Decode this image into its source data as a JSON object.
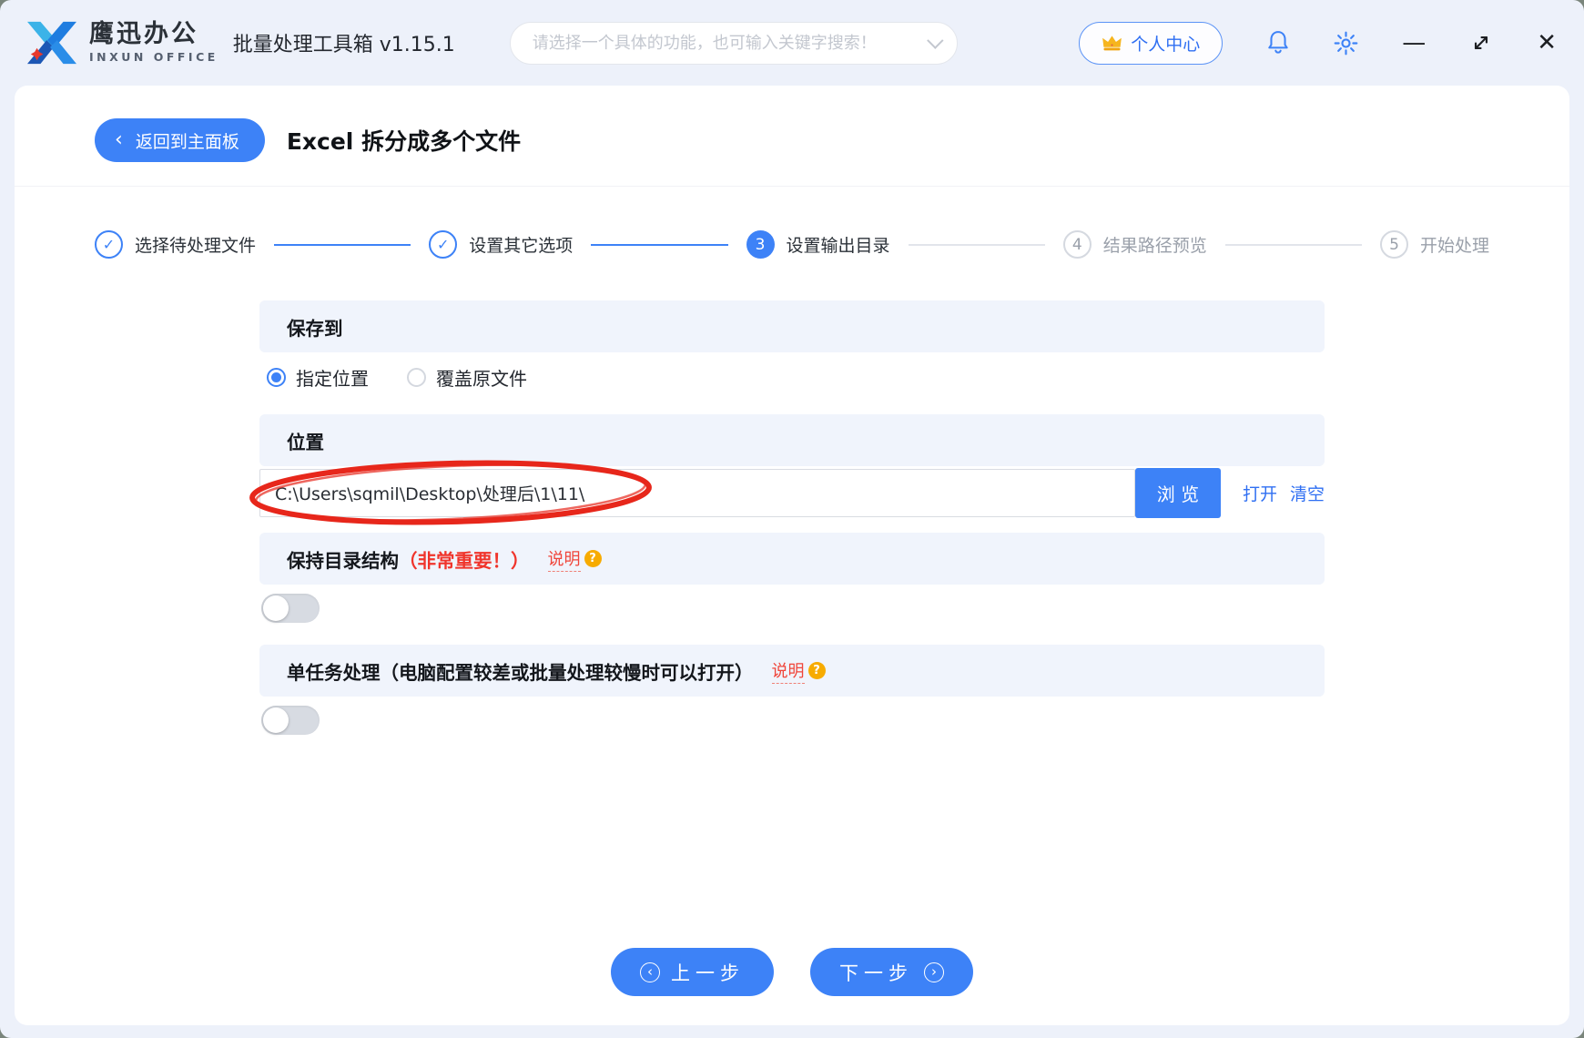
{
  "app": {
    "brand_cn": "鹰迅办公",
    "brand_en": "INXUN OFFICE",
    "title": "批量处理工具箱 v1.15.1"
  },
  "header": {
    "search_placeholder": "请选择一个具体的功能，也可输入关键字搜索！",
    "user_center_label": "个人中心"
  },
  "page": {
    "back_label": "返回到主面板",
    "title": "Excel 拆分成多个文件"
  },
  "steps": [
    {
      "num": "1",
      "label": "选择待处理文件",
      "state": "done"
    },
    {
      "num": "2",
      "label": "设置其它选项",
      "state": "done"
    },
    {
      "num": "3",
      "label": "设置输出目录",
      "state": "active"
    },
    {
      "num": "4",
      "label": "结果路径预览",
      "state": "pending"
    },
    {
      "num": "5",
      "label": "开始处理",
      "state": "pending"
    }
  ],
  "save_to": {
    "title": "保存到",
    "option_specified": "指定位置",
    "option_overwrite": "覆盖原文件",
    "selected": "指定位置"
  },
  "location": {
    "title": "位置",
    "path": "C:\\Users\\sqmil\\Desktop\\处理后\\1\\11\\",
    "browse": "浏 览",
    "open": "打开",
    "clear": "清空"
  },
  "keep_structure": {
    "title": "保持目录结构",
    "important": "（非常重要！）",
    "help": "说明",
    "help_q": "?",
    "state": "off"
  },
  "single_task": {
    "title": "单任务处理（电脑配置较差或批量处理较慢时可以打开）",
    "help": "说明",
    "help_q": "?",
    "state": "off"
  },
  "footer": {
    "prev": "上一步",
    "next": "下一步"
  },
  "glyphs": {
    "check": "✓",
    "chev_left": "‹",
    "chev_right": "›",
    "minimize": "—",
    "close": "✕"
  },
  "colors": {
    "accent": "#3d82f7",
    "section_bg": "#f0f4fc",
    "warning_red": "#f0342b",
    "help_orange": "#f7ab00",
    "annotation_red": "#e7271b"
  }
}
